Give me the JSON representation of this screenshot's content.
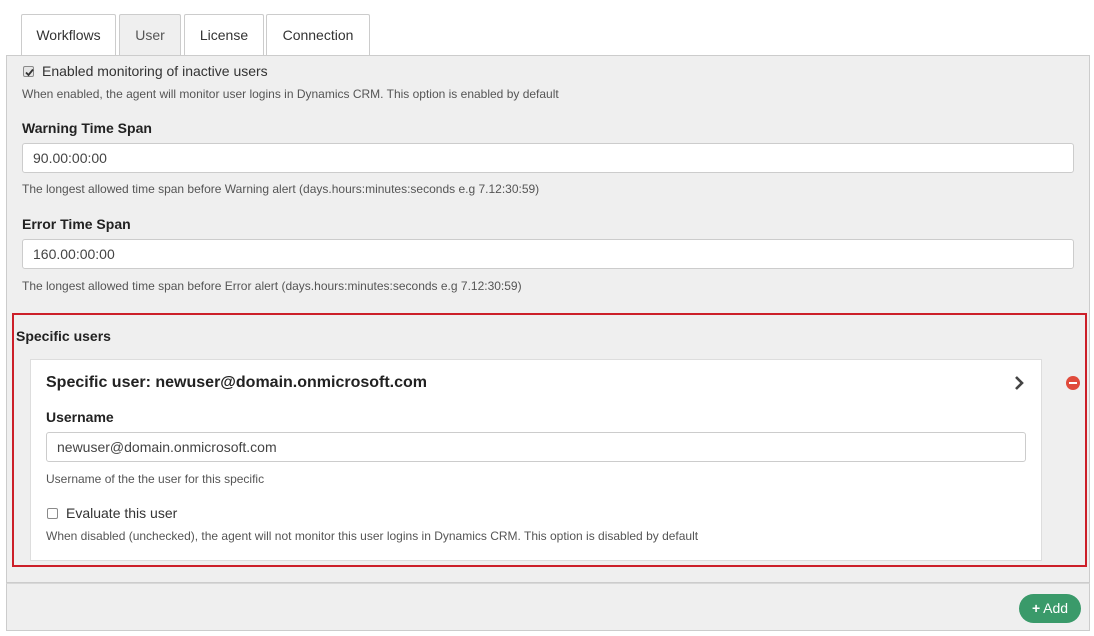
{
  "tabs": [
    {
      "label": "Workflows",
      "active": false
    },
    {
      "label": "User",
      "active": true
    },
    {
      "label": "License",
      "active": false
    },
    {
      "label": "Connection",
      "active": false
    }
  ],
  "monitoring": {
    "label": "Enabled monitoring of inactive users",
    "checked": true,
    "help": "When enabled, the agent will monitor user logins in Dynamics CRM. This option is enabled by default"
  },
  "warning": {
    "label": "Warning Time Span",
    "value": "90.00:00:00",
    "help": "The longest allowed time span before Warning alert (days.hours:minutes:seconds e.g 7.12:30:59)"
  },
  "error": {
    "label": "Error Time Span",
    "value": "160.00:00:00",
    "help": "The longest allowed time span before Error alert (days.hours:minutes:seconds e.g 7.12:30:59)"
  },
  "specific": {
    "heading": "Specific users",
    "card_title": "Specific user: newuser@domain.onmicrosoft.com",
    "username_label": "Username",
    "username_value": "newuser@domain.onmicrosoft.com",
    "username_help": "Username of the the user for this specific",
    "evaluate_label": "Evaluate this user",
    "evaluate_checked": false,
    "evaluate_help": "When disabled (unchecked), the agent will not monitor this user logins in Dynamics CRM. This option is disabled by default"
  },
  "footer": {
    "add_label": "Add",
    "add_color": "#3a9a6a"
  },
  "colors": {
    "highlight": "#cc1f29",
    "remove": "#e04b3c"
  },
  "icons": {
    "add": "plus-icon",
    "remove": "minus-circle-icon",
    "expand": "chevron-right-icon",
    "check": "check-icon"
  }
}
